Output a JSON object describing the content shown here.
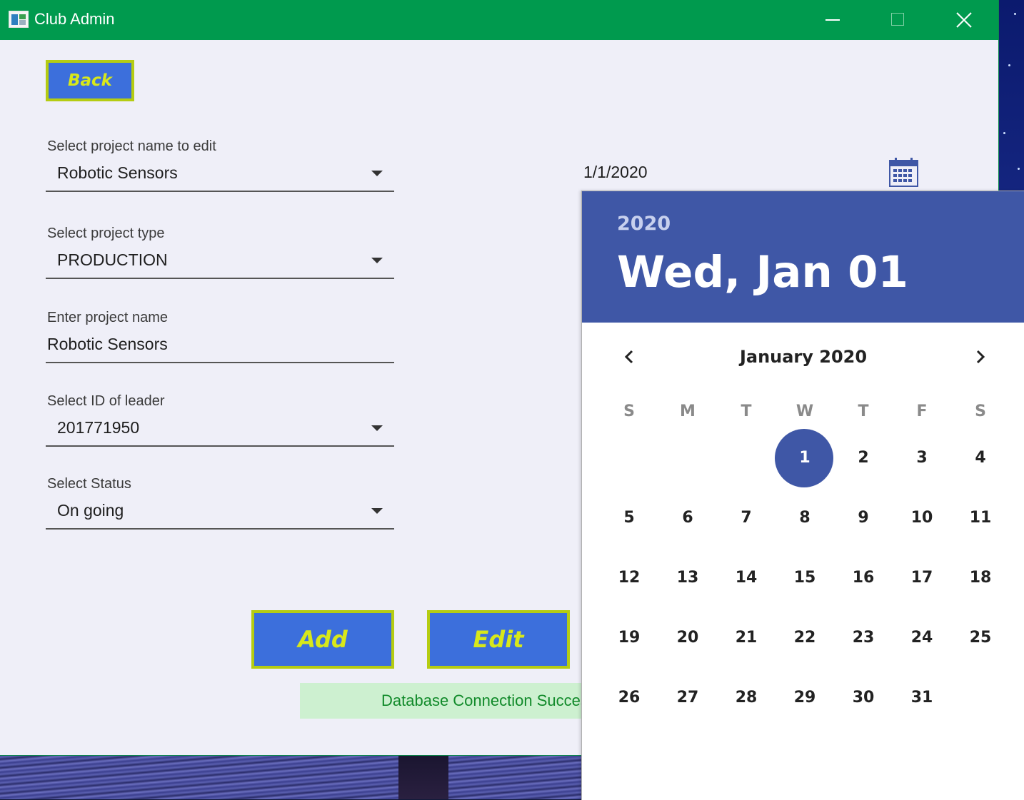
{
  "window": {
    "title": "Club Admin"
  },
  "buttons": {
    "back": "Back",
    "add": "Add",
    "edit": "Edit"
  },
  "fields": {
    "project_select": {
      "label": "Select project name to edit",
      "value": "Robotic Sensors"
    },
    "project_type": {
      "label": "Select project type",
      "value": "PRODUCTION"
    },
    "project_name": {
      "label": "Enter project name",
      "value": "Robotic Sensors"
    },
    "leader_id": {
      "label": "Select ID of leader",
      "value": "201771950"
    },
    "status": {
      "label": "Select Status",
      "value": "On going"
    }
  },
  "date_input": {
    "value": "1/1/2020"
  },
  "status_message": "Database Connection Successful",
  "calendar": {
    "year": "2020",
    "selected_date": "Wed, Jan 01",
    "month_label": "January 2020",
    "weekdays": [
      "S",
      "M",
      "T",
      "W",
      "T",
      "F",
      "S"
    ],
    "days": [
      "1",
      "2",
      "3",
      "4",
      "5",
      "6",
      "7",
      "8",
      "9",
      "10",
      "11",
      "12",
      "13",
      "14",
      "15",
      "16",
      "17",
      "18",
      "19",
      "20",
      "21",
      "22",
      "23",
      "24",
      "25",
      "26",
      "27",
      "28",
      "29",
      "30",
      "31"
    ],
    "selected_day": "1",
    "accent_color": "#3f57a6"
  },
  "colors": {
    "titlebar": "#009a4e",
    "button_bg": "#3c6fdc",
    "button_text": "#d8e81a",
    "button_border": "#b5cc12"
  }
}
